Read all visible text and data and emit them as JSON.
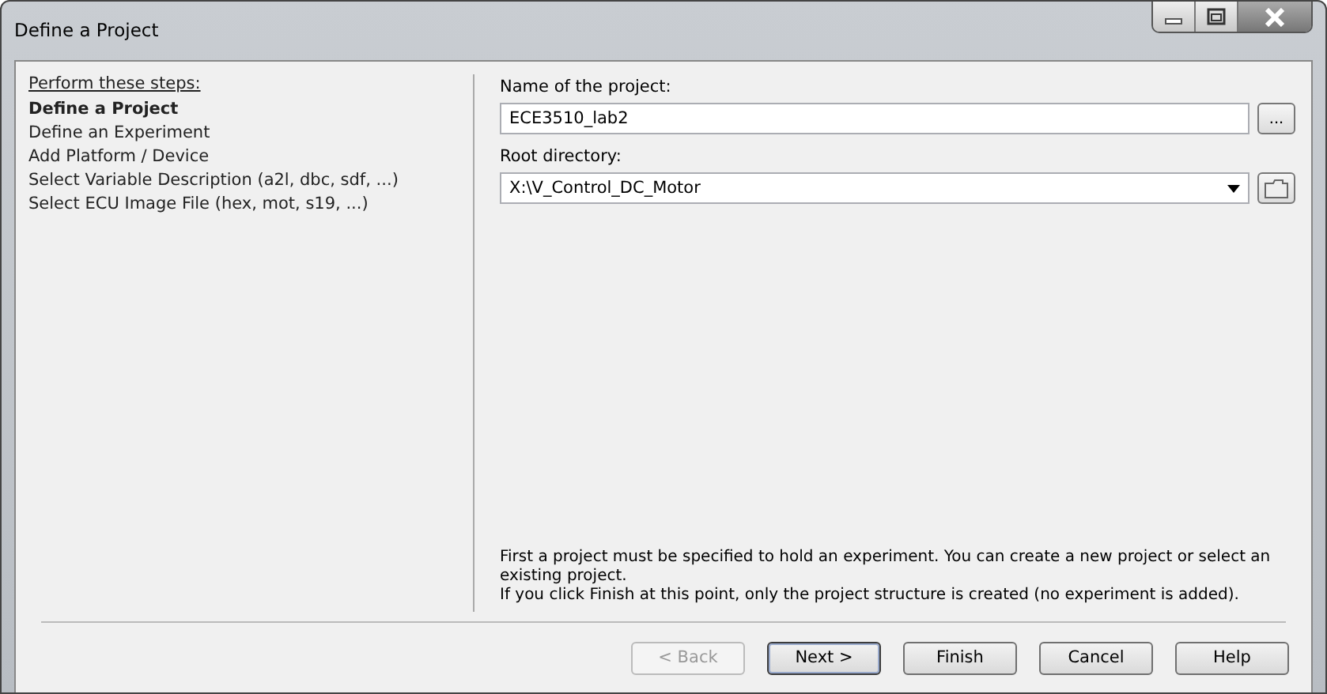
{
  "window": {
    "title": "Define a Project"
  },
  "steps": {
    "heading": "Perform these steps:",
    "items": [
      {
        "label": "Define a Project",
        "selected": true
      },
      {
        "label": "Define an Experiment",
        "selected": false
      },
      {
        "label": "Add Platform / Device",
        "selected": false
      },
      {
        "label": "Select Variable Description (a2l, dbc, sdf, ...)",
        "selected": false
      },
      {
        "label": "Select ECU Image File (hex, mot, s19, ...)",
        "selected": false
      }
    ]
  },
  "project_name": {
    "label": "Name of the project:",
    "value": "ECE3510_lab2",
    "browse": "..."
  },
  "root_directory": {
    "label": "Root directory:",
    "value": "X:\\V_Control_DC_Motor"
  },
  "description": [
    "First a project must be specified to hold an experiment. You can create a new project or select an existing project.",
    "If you click Finish at this point, only the project structure is created (no experiment is added)."
  ],
  "buttons": [
    {
      "label": "< Back",
      "disabled": true,
      "default": false
    },
    {
      "label": "Next >",
      "disabled": false,
      "default": true
    },
    {
      "label": "Finish",
      "disabled": false,
      "default": false
    },
    {
      "label": "Cancel",
      "disabled": false,
      "default": false
    },
    {
      "label": "Help",
      "disabled": false,
      "default": false
    }
  ]
}
